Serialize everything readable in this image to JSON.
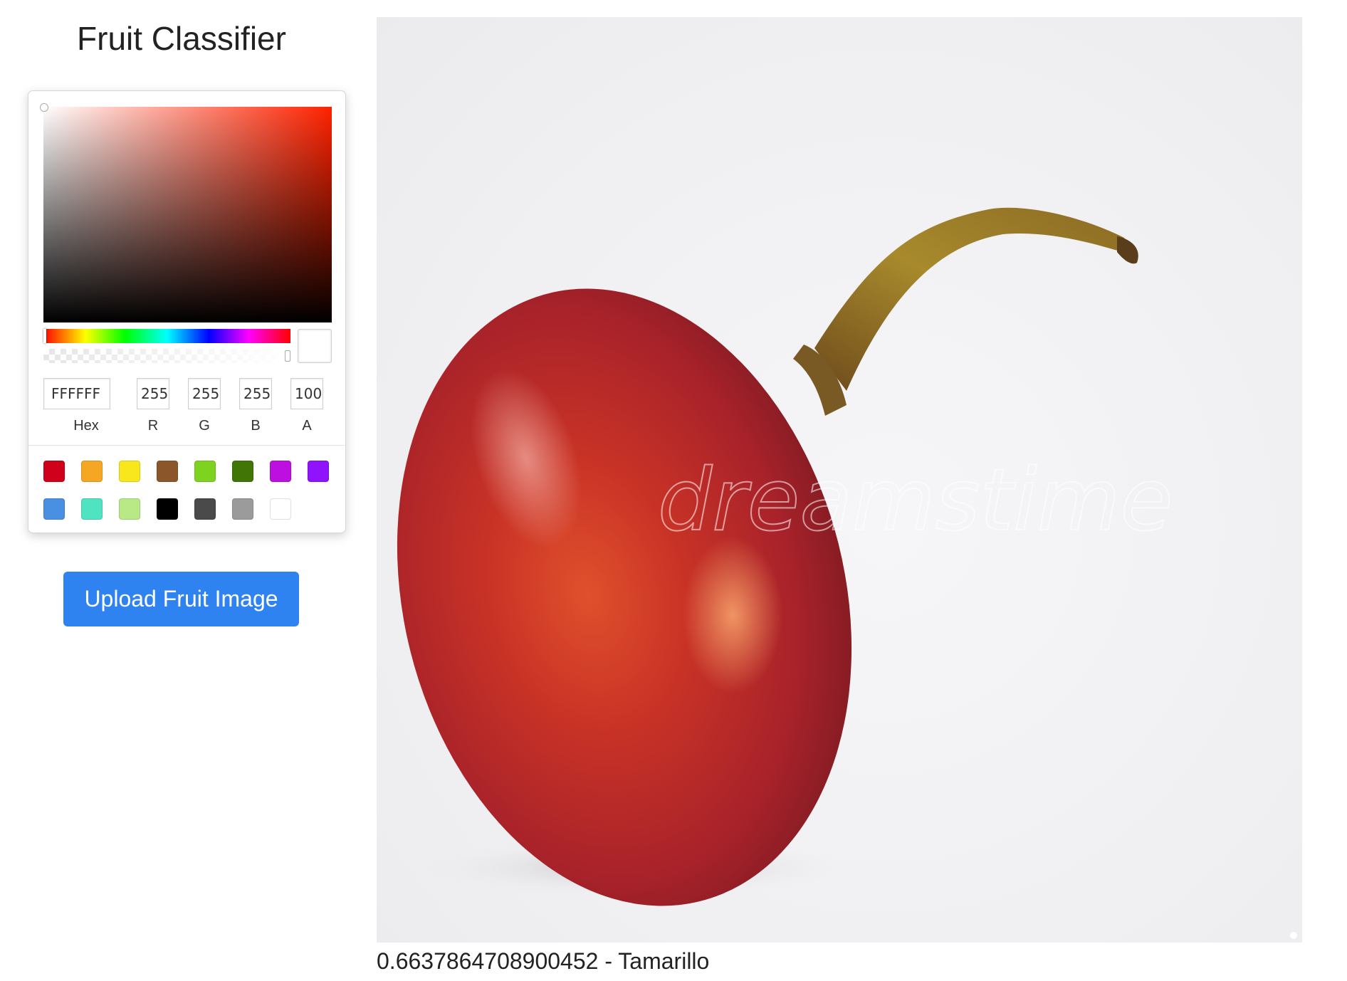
{
  "app": {
    "title": "Fruit Classifier"
  },
  "color_picker": {
    "hex": {
      "value": "FFFFFF",
      "label": "Hex"
    },
    "r": {
      "value": "255",
      "label": "R"
    },
    "g": {
      "value": "255",
      "label": "G"
    },
    "b": {
      "value": "255",
      "label": "B"
    },
    "a": {
      "value": "100",
      "label": "A"
    },
    "selected_color": "#FFFFFF",
    "hue_color": "#FF2200",
    "swatches": [
      "#D0021B",
      "#F5A623",
      "#F8E71C",
      "#8B572A",
      "#7ED321",
      "#417505",
      "#BD10E0",
      "#9013FE",
      "#4A90E2",
      "#50E3C2",
      "#B8E986",
      "#000000",
      "#4A4A4A",
      "#9B9B9B",
      "#FFFFFF"
    ]
  },
  "upload": {
    "label": "Upload Fruit Image"
  },
  "image": {
    "subject": "tamarillo",
    "watermark": "dreamstime"
  },
  "prediction": {
    "text": "0.6637864708900452 - Tamarillo"
  },
  "colors": {
    "button": "#2F83F0"
  }
}
